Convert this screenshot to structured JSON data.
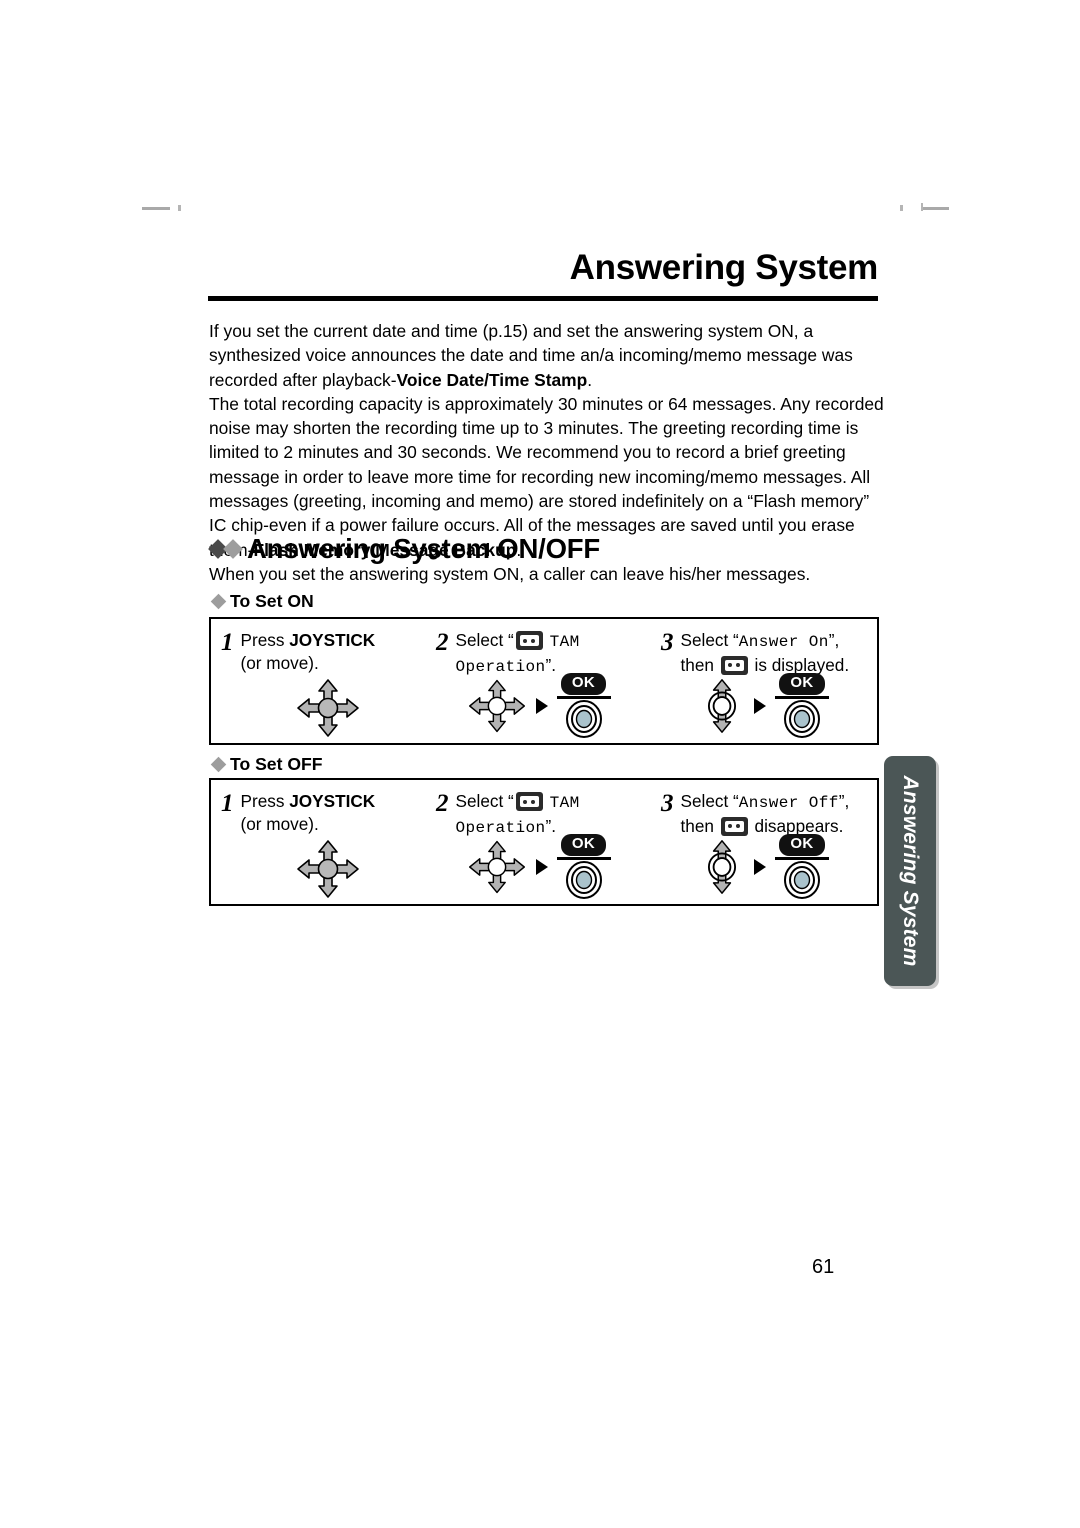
{
  "header": {
    "title": "Answering System"
  },
  "intro": {
    "paragraph1_a": "If you set the current date and time (p.15) and set the answering system ON, a synthesized voice announces the date and time an/a incoming/memo message was recorded after playback-",
    "paragraph1_bold": "Voice Date/Time Stamp",
    "paragraph1_b": ".",
    "paragraph2_a": "The total recording capacity is approximately 30 minutes or 64 messages. Any recorded noise may shorten the recording time up to 3 minutes. The greeting recording time is limited to 2 minutes and 30 seconds. We recommend you to record a brief greeting message in order to leave more time for recording new incoming/memo messages. All messages (greeting, incoming and memo) are stored indefinitely on a “Flash memory” IC chip-even if a power failure occurs. All of the messages are saved until you erase them-",
    "paragraph2_bold": "Flash Memory Message Backup",
    "paragraph2_b": "."
  },
  "section": {
    "heading": "Answering System ON/OFF",
    "subtitle": "When you set the answering system ON, a caller can leave his/her messages."
  },
  "set_on": {
    "label": "To Set ON",
    "steps": [
      {
        "number": "1",
        "line1_pre": "Press ",
        "line1_bold": "JOYSTICK",
        "line2": "(or move)."
      },
      {
        "number": "2",
        "text_pre": "Select “",
        "text_mono_after_icon": "TAM",
        "text_mono_line2": "Operation",
        "text_post": "”.",
        "ok_label": "OK"
      },
      {
        "number": "3",
        "text_pre": "Select “",
        "text_mono": "Answer On",
        "text_post": "”,",
        "line2_pre": "then ",
        "line2_post": "is displayed.",
        "ok_label": "OK"
      }
    ]
  },
  "set_off": {
    "label": "To Set OFF",
    "steps": [
      {
        "number": "1",
        "line1_pre": "Press ",
        "line1_bold": "JOYSTICK",
        "line2": "(or move)."
      },
      {
        "number": "2",
        "text_pre": "Select “",
        "text_mono_after_icon": "TAM",
        "text_mono_line2": "Operation",
        "text_post": "”.",
        "ok_label": "OK"
      },
      {
        "number": "3",
        "text_pre": "Select “",
        "text_mono": "Answer Off",
        "text_post": "”,",
        "line2_pre": "then ",
        "line2_post": "disappears.",
        "ok_label": "OK"
      }
    ]
  },
  "side_tab": {
    "text": "Answering System",
    "color": "#4b5656"
  },
  "footer": {
    "page_number": "61"
  }
}
